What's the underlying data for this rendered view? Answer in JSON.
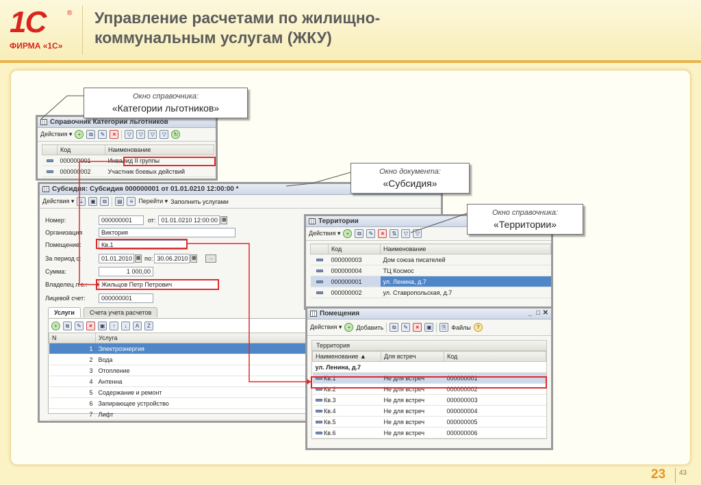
{
  "slide": {
    "title_line1": "Управление расчетами по жилищно-",
    "title_line2": "коммунальным услугам (ЖКУ)",
    "logo_text": "1С",
    "logo_reg": "®",
    "logo_firma": "ФИРМА «1С»",
    "page_number": "23",
    "page_total": "43"
  },
  "callouts": {
    "categories": {
      "line1": "Окно справочника:",
      "line2": "«Категории льготников»"
    },
    "subsidy": {
      "line1": "Окно документа:",
      "line2": "«Субсидия»"
    },
    "territories": {
      "line1": "Окно справочника:",
      "line2": "«Территории»"
    }
  },
  "win_categories": {
    "title": "Справочник Категории льготников",
    "actions": "Действия ▾",
    "col_code": "Код",
    "col_name": "Наименование",
    "rows": [
      {
        "code": "000000001",
        "name": "Инвалид II группы"
      },
      {
        "code": "000000002",
        "name": "Участник боевых действий"
      }
    ]
  },
  "win_subsidy": {
    "title": "Субсидия: Субсидия 000000001 от 01.01.0210 12:00:00 *",
    "actions": "Действия ▾",
    "goto": "Перейти ▾",
    "fill": "Заполнить услугами",
    "number_label": "Номер:",
    "number_value": "000000001",
    "date_label": "от:",
    "date_value": "01.01.0210 12:00:00",
    "org_label": "Организация",
    "org_value": "Виктория",
    "premises_label": "Помещение:",
    "premises_value": "Кв.1",
    "period_label": "За период с:",
    "period_from": "01.01.2010",
    "period_to_label": "по:",
    "period_to": "30.06.2010",
    "sum_label": "Сумма:",
    "sum_value": "1 000,00",
    "owner_label": "Владелец л.с.:",
    "owner_value": "Жильцов Петр Петрович",
    "account_label": "Лицевой счет:",
    "account_value": "000000001",
    "tab_services": "Услуги",
    "tab_accounts": "Счета учета расчетов",
    "col_n": "N",
    "col_service": "Услуга",
    "services": [
      {
        "n": "1",
        "name": "Электроэнергия"
      },
      {
        "n": "2",
        "name": "Вода"
      },
      {
        "n": "3",
        "name": "Отопление"
      },
      {
        "n": "4",
        "name": "Антенна"
      },
      {
        "n": "5",
        "name": "Содержание и ремонт"
      },
      {
        "n": "6",
        "name": "Запирающее устройство"
      },
      {
        "n": "7",
        "name": "Лифт"
      }
    ]
  },
  "win_territories": {
    "title": "Территории",
    "actions": "Действия ▾",
    "col_code": "Код",
    "col_name": "Наименование",
    "rows": [
      {
        "code": "000000003",
        "name": "Дом союза писателей"
      },
      {
        "code": "000000004",
        "name": "ТЦ Космос"
      },
      {
        "code": "000000001",
        "name": "ул. Ленина, д.7"
      },
      {
        "code": "000000002",
        "name": "ул. Ставропольская, д.7"
      }
    ]
  },
  "win_premises": {
    "title": "Помещения",
    "actions": "Действия ▾",
    "add": "Добавить",
    "files": "Файлы",
    "group_label": "Территория",
    "col_name": "Наименование",
    "col_meet": "Для встреч",
    "col_code": "Код",
    "group_row": "ул. Ленина, д.7",
    "rows": [
      {
        "name": "Кв.1",
        "meet": "Не для встреч",
        "code": "000000001"
      },
      {
        "name": "Кв.2",
        "meet": "Не для встреч",
        "code": "000000002"
      },
      {
        "name": "Кв.3",
        "meet": "Не для встреч",
        "code": "000000003"
      },
      {
        "name": "Кв.4",
        "meet": "Не для встреч",
        "code": "000000004"
      },
      {
        "name": "Кв.5",
        "meet": "Не для встреч",
        "code": "000000005"
      },
      {
        "name": "Кв.6",
        "meet": "Не для встреч",
        "code": "000000006"
      }
    ]
  },
  "colors": {
    "accent": "#e02a2a",
    "selection": "#4f86c8",
    "logo": "#d8261c"
  }
}
